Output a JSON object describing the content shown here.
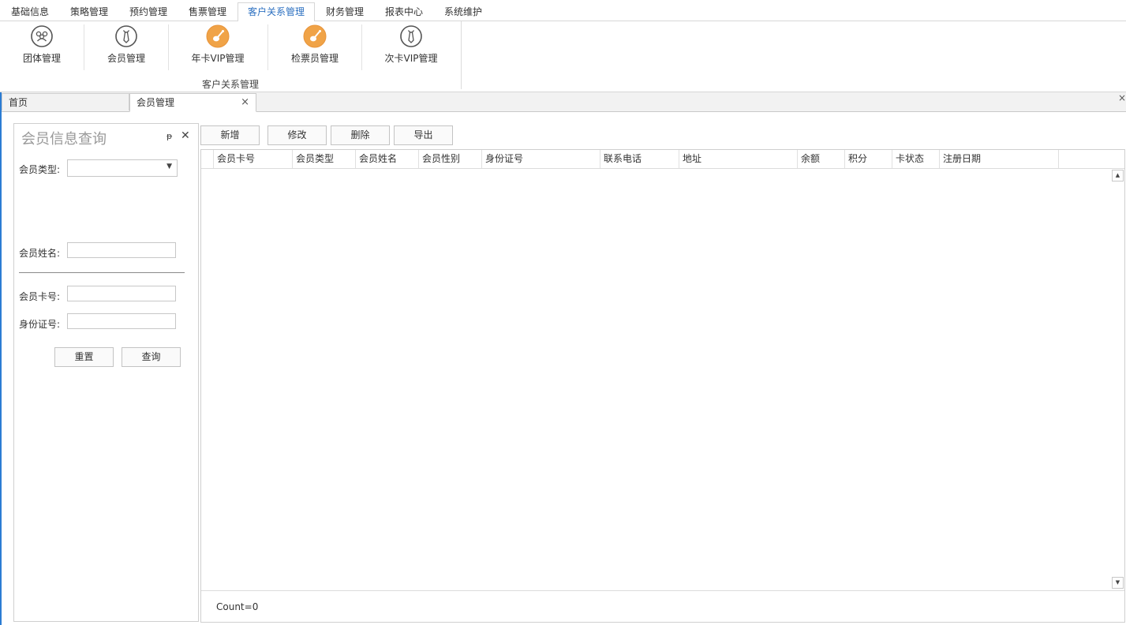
{
  "menu": {
    "tabs": [
      {
        "label": "基础信息"
      },
      {
        "label": "策略管理"
      },
      {
        "label": "预约管理"
      },
      {
        "label": "售票管理"
      },
      {
        "label": "客户关系管理"
      },
      {
        "label": "财务管理"
      },
      {
        "label": "报表中心"
      },
      {
        "label": "系统维护"
      }
    ],
    "active": "客户关系管理"
  },
  "ribbon": {
    "buttons": [
      {
        "label": "团体管理",
        "icon": "group-icon"
      },
      {
        "label": "会员管理",
        "icon": "tie-icon"
      },
      {
        "label": "年卡VIP管理",
        "icon": "guitar-icon"
      },
      {
        "label": "检票员管理",
        "icon": "guitar-icon"
      },
      {
        "label": "次卡VIP管理",
        "icon": "tie-icon"
      }
    ],
    "group_label": "客户关系管理",
    "accent_color": "#f0a347"
  },
  "doc_tabs": {
    "tabs": [
      {
        "label": "首页"
      },
      {
        "label": "会员管理"
      }
    ],
    "close_glyph": "×",
    "far_close_glyph": "×"
  },
  "query_panel": {
    "title": "会员信息查询",
    "pin_glyph": "ᵽ",
    "close_glyph": "✕",
    "fields": {
      "member_type_label": "会员类型:",
      "member_type_value": "",
      "member_name_label": "会员姓名:",
      "member_name_value": "",
      "card_no_label": "会员卡号:",
      "card_no_value": "",
      "id_no_label": "身份证号:",
      "id_no_value": ""
    },
    "reset_label": "重置",
    "query_label": "查询"
  },
  "toolbar": {
    "add_label": "新增",
    "edit_label": "修改",
    "delete_label": "删除",
    "export_label": "导出"
  },
  "grid": {
    "columns": [
      "会员卡号",
      "会员类型",
      "会员姓名",
      "会员性别",
      "身份证号",
      "联系电话",
      "地址",
      "余额",
      "积分",
      "卡状态",
      "注册日期"
    ],
    "rows": [],
    "count_text": "Count=0"
  }
}
